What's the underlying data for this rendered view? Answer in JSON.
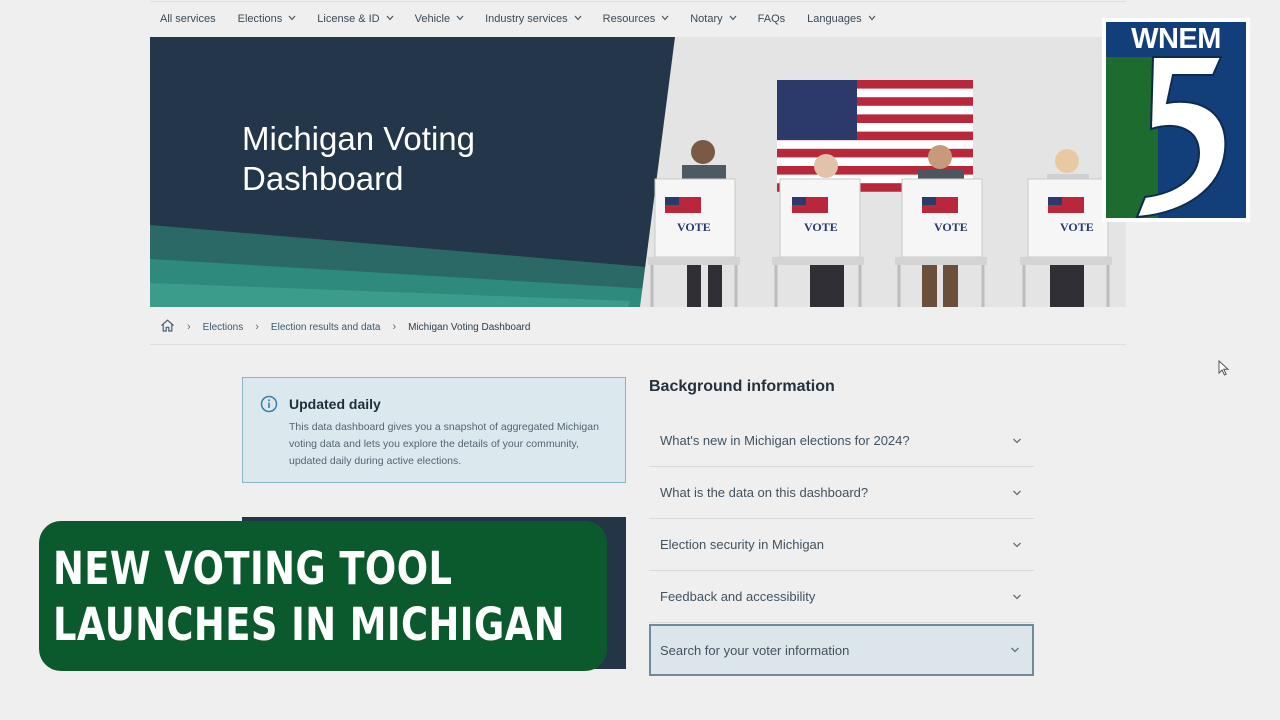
{
  "nav": {
    "items": [
      {
        "label": "All services",
        "has_dropdown": false
      },
      {
        "label": "Elections",
        "has_dropdown": true
      },
      {
        "label": "License & ID",
        "has_dropdown": true
      },
      {
        "label": "Vehicle",
        "has_dropdown": true
      },
      {
        "label": "Industry services",
        "has_dropdown": true
      },
      {
        "label": "Resources",
        "has_dropdown": true
      },
      {
        "label": "Notary",
        "has_dropdown": true
      },
      {
        "label": "FAQs",
        "has_dropdown": false
      },
      {
        "label": "Languages",
        "has_dropdown": true
      }
    ]
  },
  "hero": {
    "title_line1": "Michigan Voting",
    "title_line2": "Dashboard",
    "booth_label": "VOTE"
  },
  "breadcrumb": {
    "home_icon": "home-icon",
    "items": [
      "Elections",
      "Election results and data",
      "Michigan Voting Dashboard"
    ]
  },
  "info": {
    "icon": "info-icon",
    "title": "Updated daily",
    "body": "This data dashboard gives you a snapshot of aggregated Michigan voting data and lets you explore the details of your community, updated daily during active elections."
  },
  "background": {
    "heading": "Background information",
    "items": [
      "What's new in Michigan elections for 2024?",
      "What is the data on this dashboard?",
      "Election security in Michigan",
      "Feedback and accessibility",
      "Search for your voter information"
    ]
  },
  "lower_third": {
    "line1": "NEW VOTING TOOL",
    "line2": "LAUNCHES IN MICHIGAN"
  },
  "logo": {
    "text": "WNEM",
    "numeral": "5"
  },
  "colors": {
    "hero_navy": "#243649",
    "accent_teal": "#2f8a7e",
    "lower_third_green": "#0b5a2e",
    "logo_blue": "#123f7a",
    "logo_green": "#1d6b2f"
  }
}
